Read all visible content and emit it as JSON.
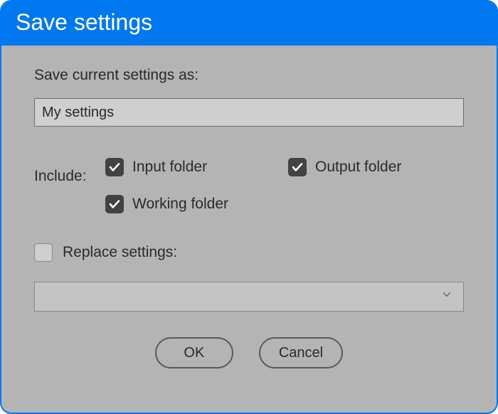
{
  "title": "Save settings",
  "prompt_label": "Save current settings as:",
  "name_value": "My settings",
  "include_label": "Include:",
  "includes": {
    "input": {
      "label": "Input folder",
      "checked": true
    },
    "output": {
      "label": "Output folder",
      "checked": true
    },
    "working": {
      "label": "Working folder",
      "checked": true
    }
  },
  "replace": {
    "label": "Replace settings:",
    "checked": false
  },
  "dropdown_value": "",
  "buttons": {
    "ok": "OK",
    "cancel": "Cancel"
  }
}
